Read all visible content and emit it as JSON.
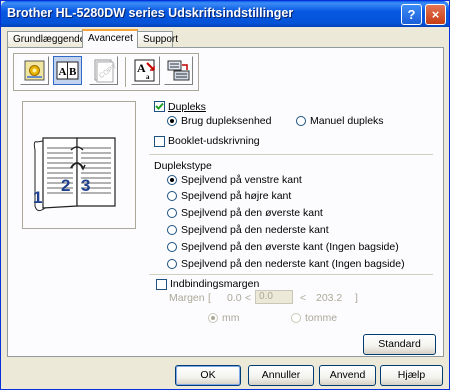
{
  "window": {
    "title": "Brother HL-5280DW series Udskriftsindstillinger",
    "help_glyph": "?",
    "close_glyph": "×"
  },
  "tabs": [
    {
      "label": "Grundlæggende"
    },
    {
      "label": "Avanceret",
      "selected": true
    },
    {
      "label": "Support"
    }
  ],
  "toolbar": {
    "icons": [
      "watermark-quality-icon",
      "duplex-ab-icon",
      "copy-stamp-icon",
      "scaling-icon",
      "device-options-icon"
    ]
  },
  "preview": {
    "page_numbers": [
      "1",
      "2",
      "3"
    ]
  },
  "duplex": {
    "label": "Dupleks",
    "checked": true,
    "unit_option": "Brug dupleksenhed",
    "manual_option": "Manuel dupleks",
    "selected": "unit"
  },
  "booklet": {
    "label": "Booklet-udskrivning",
    "checked": false
  },
  "duplex_type": {
    "heading": "Duplekstype",
    "options": [
      "Spejlvend på venstre kant",
      "Spejlvend på højre kant",
      "Spejlvend på den øverste kant",
      "Spejlvend på den nederste kant",
      "Spejlvend på den øverste kant (Ingen bagside)",
      "Spejlvend på den nederste kant (Ingen bagside)"
    ],
    "selected_index": 0
  },
  "binding_margin": {
    "label": "Indbindingsmargen",
    "checked": false,
    "margin_label": "Margen",
    "open_bracket": "[",
    "min": "0.0",
    "lt1": "<",
    "value": "0.0",
    "lt2": "<",
    "max": "203.2",
    "close_bracket": "]",
    "unit_mm": "mm",
    "unit_inch": "tomme",
    "selected_unit": "mm"
  },
  "buttons": {
    "standard": "Standard",
    "ok": "OK",
    "cancel": "Annuller",
    "apply": "Anvend",
    "help": "Hjælp"
  }
}
